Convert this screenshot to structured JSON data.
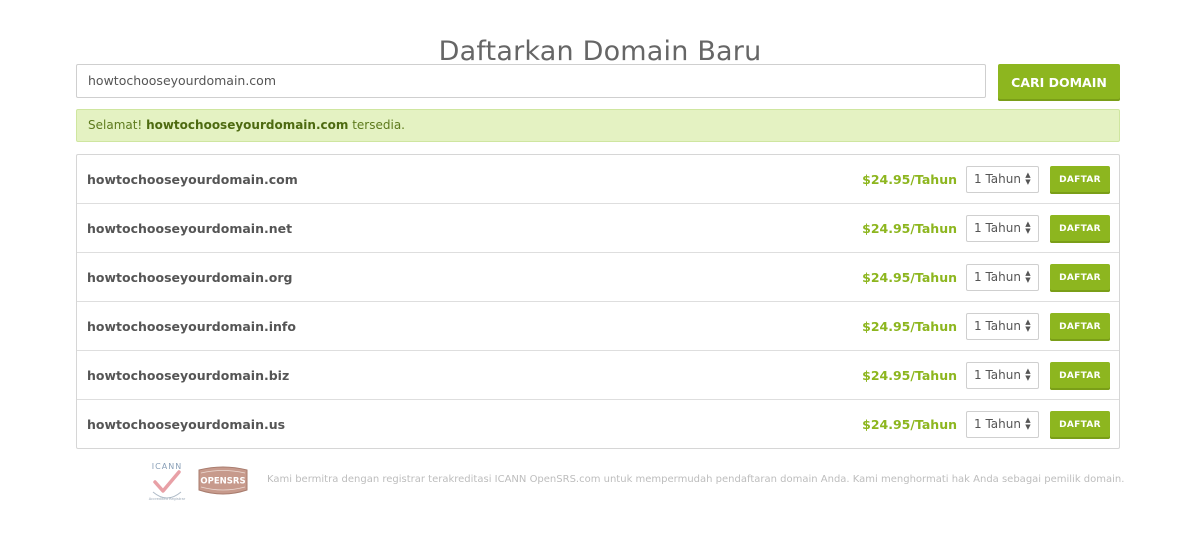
{
  "page": {
    "title": "Daftarkan Domain Baru"
  },
  "search": {
    "value": "howtochooseyourdomain.com",
    "button_label": "CARI DOMAIN"
  },
  "alert": {
    "prefix": "Selamat! ",
    "domain": "howtochooseyourdomain.com",
    "suffix": " tersedia."
  },
  "results": [
    {
      "domain": "howtochooseyourdomain.com",
      "price": "$24.95/Tahun",
      "term": "1 Tahun",
      "button": "DAFTAR"
    },
    {
      "domain": "howtochooseyourdomain.net",
      "price": "$24.95/Tahun",
      "term": "1 Tahun",
      "button": "DAFTAR"
    },
    {
      "domain": "howtochooseyourdomain.org",
      "price": "$24.95/Tahun",
      "term": "1 Tahun",
      "button": "DAFTAR"
    },
    {
      "domain": "howtochooseyourdomain.info",
      "price": "$24.95/Tahun",
      "term": "1 Tahun",
      "button": "DAFTAR"
    },
    {
      "domain": "howtochooseyourdomain.biz",
      "price": "$24.95/Tahun",
      "term": "1 Tahun",
      "button": "DAFTAR"
    },
    {
      "domain": "howtochooseyourdomain.us",
      "price": "$24.95/Tahun",
      "term": "1 Tahun",
      "button": "DAFTAR"
    }
  ],
  "footer": {
    "text": "Kami bermitra dengan registrar terakreditasi ICANN OpenSRS.com untuk mempermudah pendaftaran domain Anda. Kami menghormati hak Anda sebagai pemilik domain.",
    "icann_logo_text": "ICANN",
    "icann_logo_subtext": "Accredited Registrar",
    "opensrs_logo_text": "OPENSRS"
  },
  "colors": {
    "accent": "#8db61f",
    "alert_bg": "#e4f2c2",
    "price": "#8db61f"
  },
  "icons": [
    "select-arrows-icon",
    "icann-checkmark-icon",
    "opensrs-badge-icon"
  ]
}
